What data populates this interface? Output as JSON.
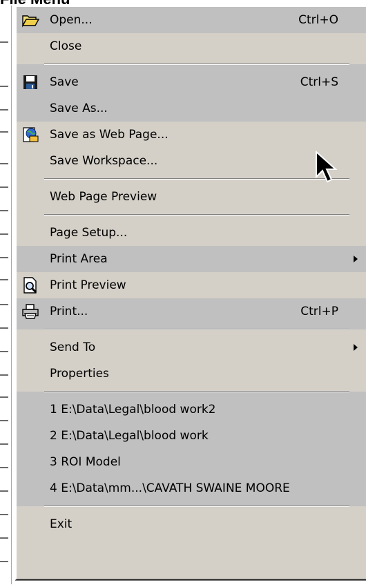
{
  "title": "File Menu",
  "menu": {
    "open": {
      "label": "Open...",
      "shortcut": "Ctrl+O"
    },
    "close": {
      "label": "Close"
    },
    "save": {
      "label": "Save",
      "shortcut": "Ctrl+S"
    },
    "save_as": {
      "label": "Save As..."
    },
    "save_web": {
      "label": "Save as Web Page..."
    },
    "save_workspace": {
      "label": "Save Workspace..."
    },
    "web_preview": {
      "label": "Web Page Preview"
    },
    "page_setup": {
      "label": "Page Setup..."
    },
    "print_area": {
      "label": "Print Area"
    },
    "print_preview": {
      "label": "Print Preview"
    },
    "print": {
      "label": "Print...",
      "shortcut": "Ctrl+P"
    },
    "send_to": {
      "label": "Send To"
    },
    "properties": {
      "label": "Properties"
    },
    "recent": [
      {
        "label": "1 E:\\Data\\Legal\\blood work2"
      },
      {
        "label": "2 E:\\Data\\Legal\\blood work"
      },
      {
        "label": "3 ROI Model"
      },
      {
        "label": "4 E:\\Data\\mm...\\CAVATH SWAINE MOORE"
      }
    ],
    "exit": {
      "label": "Exit"
    }
  },
  "icons": {
    "open": "folder-open-icon",
    "save": "floppy-disk-icon",
    "save_web": "web-page-icon",
    "print_preview": "print-preview-icon",
    "print": "printer-icon",
    "submenu": "submenu-arrow-icon",
    "cursor": "mouse-pointer-icon"
  },
  "colors": {
    "menu_bg": "#d4d0c8",
    "highlight_bg": "#c0c0c0"
  }
}
